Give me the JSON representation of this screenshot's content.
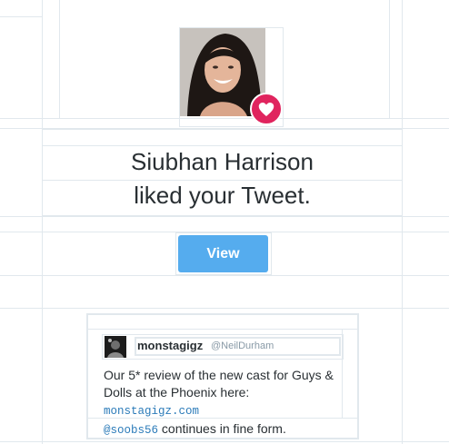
{
  "notification": {
    "actor_name": "Siubhan Harrison",
    "action_text": "liked your Tweet.",
    "view_button_label": "View"
  },
  "tweet": {
    "author_name": "monstagigz",
    "author_handle": "@NeilDurham",
    "text_part1": "Our 5* review of the new cast for Guys & Dolls at the Phoenix here: ",
    "link_text": "monstagigz.com",
    "mention_text": "@soobs56",
    "text_part2": " continues in fine form."
  },
  "colors": {
    "accent": "#55acee",
    "like_badge": "#e0245e",
    "link": "#2b7bb9",
    "divider": "#e1e8ed"
  },
  "icons": {
    "avatar": "profile-photo",
    "badge": "heart-icon"
  }
}
